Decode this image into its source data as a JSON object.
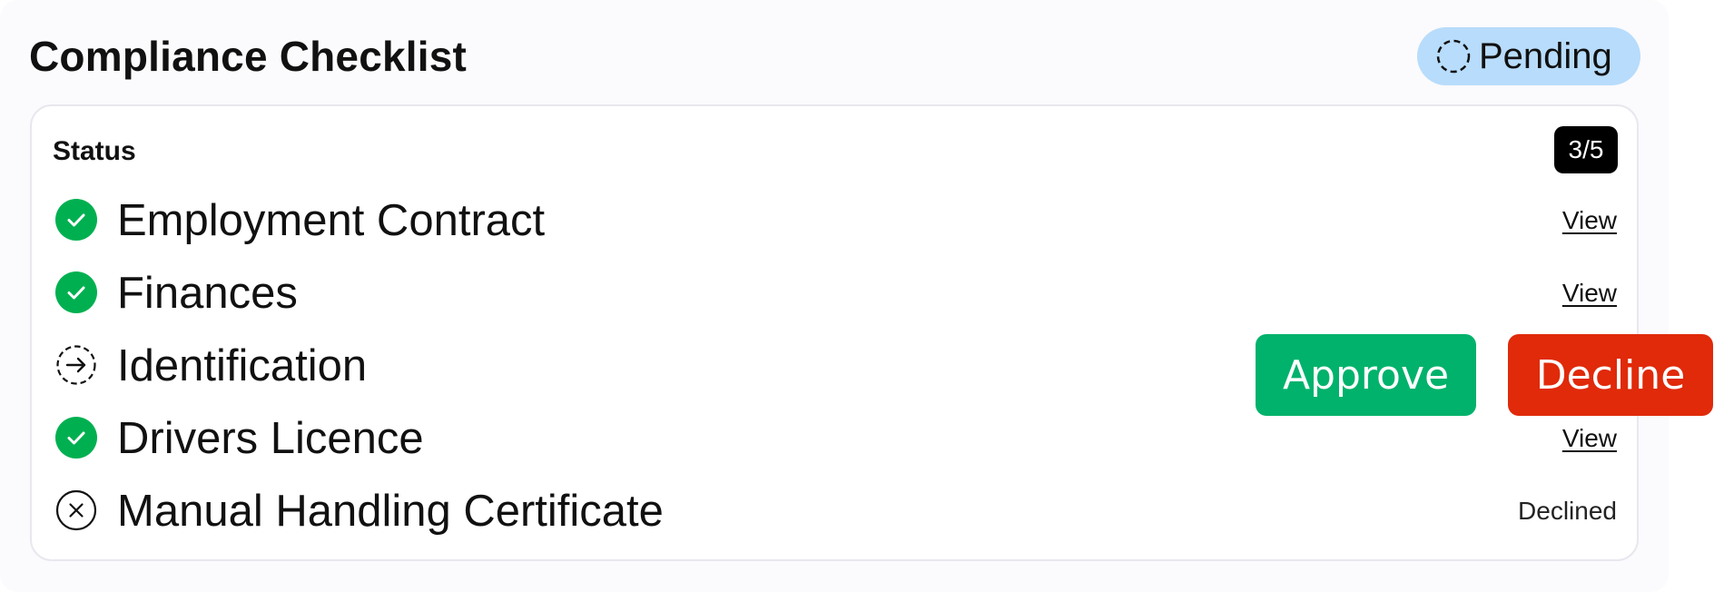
{
  "header": {
    "title": "Compliance Checklist",
    "status_pill": {
      "label": "Pending",
      "icon": "dashed-circle-icon",
      "color": "#b8dcfb"
    }
  },
  "panel": {
    "status_label": "Status",
    "progress_badge": "3/5",
    "items": [
      {
        "label": "Employment Contract",
        "state": "complete",
        "icon": "check-circle-icon",
        "action": "View"
      },
      {
        "label": "Finances",
        "state": "complete",
        "icon": "check-circle-icon",
        "action": "View"
      },
      {
        "label": "Identification",
        "state": "in-review",
        "icon": "arrow-dashed-circle-icon",
        "action": ""
      },
      {
        "label": "Drivers Licence",
        "state": "complete",
        "icon": "check-circle-icon",
        "action": "View"
      },
      {
        "label": "Manual Handling Certificate",
        "state": "declined",
        "icon": "x-circle-icon",
        "status_text": "Declined"
      }
    ]
  },
  "actions": {
    "approve_label": "Approve",
    "decline_label": "Decline",
    "approve_color": "#00b26b",
    "decline_color": "#e02a0a"
  },
  "colors": {
    "success": "#00b050"
  }
}
